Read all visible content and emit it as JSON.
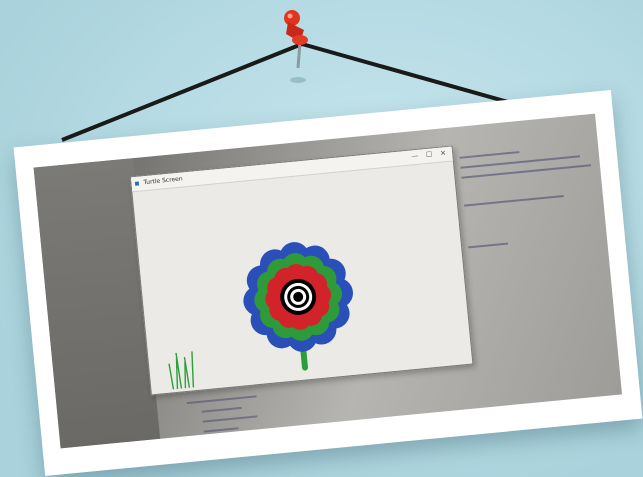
{
  "scene": {
    "wall_color": "#b9dde6",
    "frame_color": "#ffffff",
    "pin_color": "#e0341f",
    "string_color": "#1a1a1a"
  },
  "turtle_window": {
    "title": "Turtle Screen",
    "title_icon": "turtle-python-icon",
    "minimize_glyph": "—",
    "maximize_glyph": "☐",
    "close_glyph": "✕"
  },
  "drawing": {
    "petal_colors": [
      "#2b4fb8",
      "#2e9a3a",
      "#d3232a"
    ],
    "center_rings": [
      "#000000",
      "#ffffff",
      "#000000",
      "#ffffff",
      "#000000"
    ],
    "stem_color": "#2aa03a",
    "grass_color": "#2aa03a"
  }
}
